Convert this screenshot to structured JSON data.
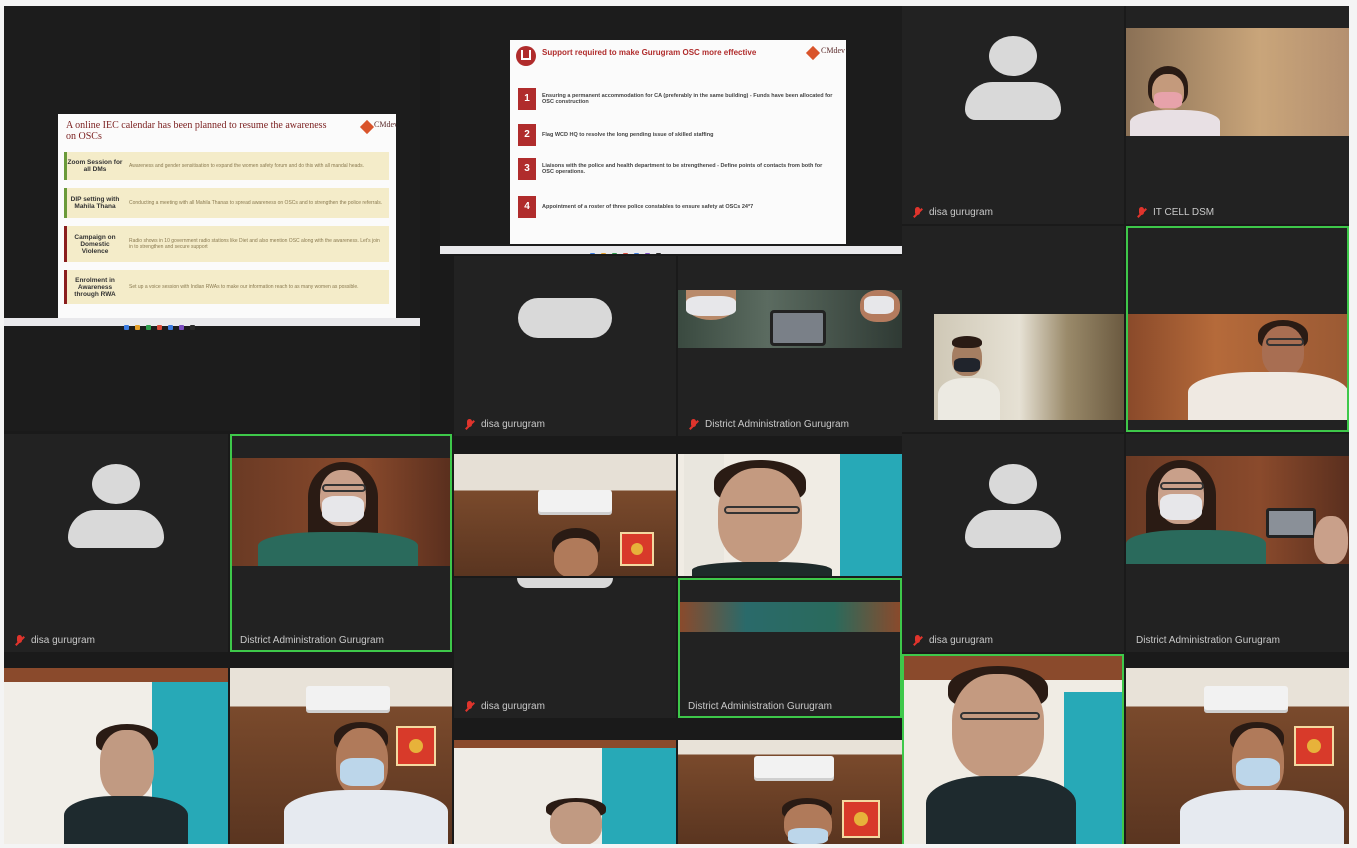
{
  "participants": {
    "disa": "disa gurugram",
    "it_cell": "IT CELL DSM",
    "district": "District Administration Gurugram"
  },
  "slide_left": {
    "title": "A online IEC calendar has been planned to resume the awareness on OSCs",
    "items": [
      {
        "label": "Zoom Session for all DMs",
        "text": "Awareness and gender sensitisation to expand the women safety forum and do this with all mandal heads."
      },
      {
        "label": "DIP setting with Mahila Thana",
        "text": "Conducting a meeting with all Mahila Thanas to spread awareness on OSCs and to strengthen the police referrals."
      },
      {
        "label": "Campaign on Domestic Violence",
        "text": "Radio shows in 10 government radio stations like Diet and also mention OSC along with the awareness. Let's join in to strengthen and secure support"
      },
      {
        "label": "Enrolment in Awareness through RWA",
        "text": "Set up a voice session with Indian RWAs to make our information reach to as many women as possible."
      }
    ]
  },
  "slide_center": {
    "title": "Support required to make Gurugram OSC more effective",
    "items": [
      {
        "num": "1",
        "text": "Ensuring a permanent accommodation for CA (preferably in the same building) - Funds have been allocated for OSC construction"
      },
      {
        "num": "2",
        "text": "Flag WCD HQ to resolve the long pending issue of skilled staffing"
      },
      {
        "num": "3",
        "text": "Liaisons with the police and health department to be strengthened - Define points of contacts from both for OSC operations."
      },
      {
        "num": "4",
        "text": "Appointment of a roster of three police constables to ensure safety at OSCs 24*7"
      }
    ]
  },
  "colors": {
    "background": "#1a1a1a",
    "active_speaker_border": "#3ec84a",
    "muted_mic": "#e0342c",
    "slide_accent": "#b02c2c"
  }
}
